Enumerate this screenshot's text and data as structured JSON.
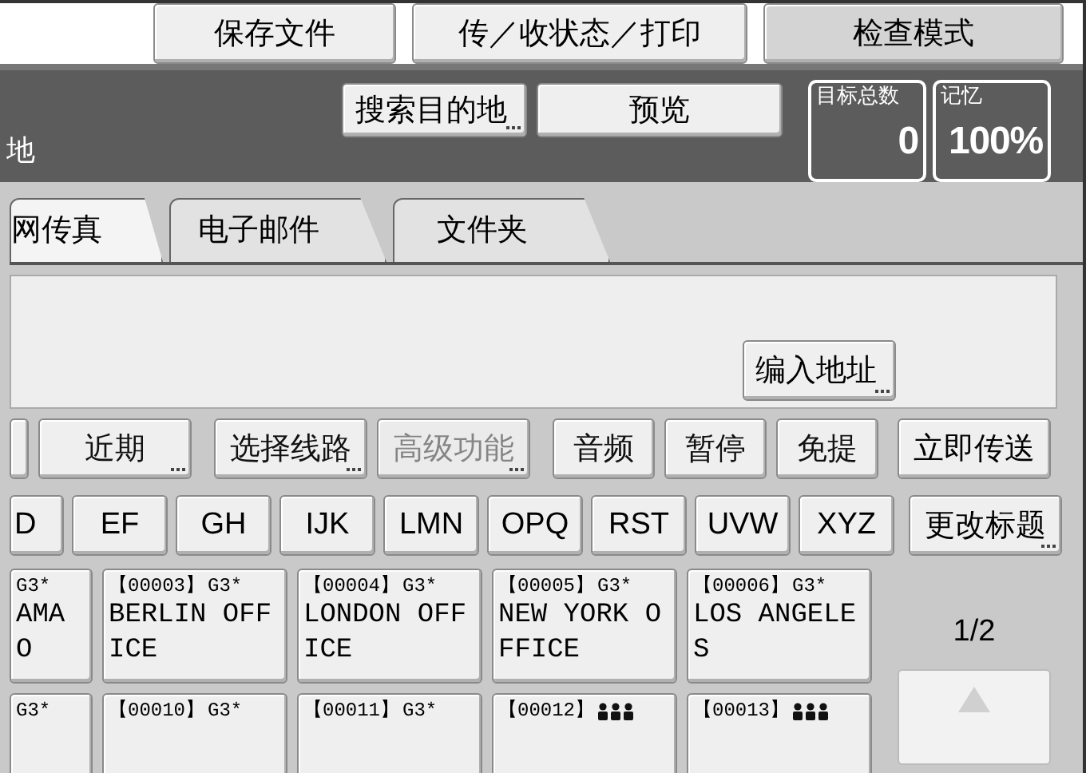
{
  "top_buttons": [
    {
      "label": "保存文件",
      "selected": false
    },
    {
      "label": "传／收状态／打印",
      "selected": false
    },
    {
      "label": "检查模式",
      "selected": true
    }
  ],
  "band": {
    "title": "地",
    "search_button": {
      "label": "搜索目的地",
      "submenu": true
    },
    "preview_button": "预览",
    "counters": [
      {
        "label": "目标总数",
        "value": "0"
      },
      {
        "label": "记忆",
        "value": "100%"
      }
    ]
  },
  "tabs": [
    {
      "label": "网传真",
      "selected": true
    },
    {
      "label": "电子邮件",
      "selected": false
    },
    {
      "label": "文件夹",
      "selected": false
    }
  ],
  "edit_address_button": {
    "label": "编入地址",
    "submenu": true
  },
  "function_buttons": [
    {
      "label": "近期",
      "submenu": true,
      "disabled": false
    },
    {
      "label": "选择线路",
      "submenu": true,
      "disabled": false
    },
    {
      "label": "高级功能",
      "submenu": true,
      "disabled": true
    },
    {
      "label": "音频",
      "submenu": false,
      "disabled": false
    },
    {
      "label": "暂停",
      "submenu": false,
      "disabled": false
    },
    {
      "label": "免提",
      "submenu": false,
      "disabled": false
    }
  ],
  "send_now_button": "立即传送",
  "index_keys": [
    "D",
    "EF",
    "GH",
    "IJK",
    "LMN",
    "OPQ",
    "RST",
    "UVW",
    "XYZ"
  ],
  "change_title_button": {
    "label": "更改标题",
    "submenu": true
  },
  "destinations": [
    [
      {
        "kind": "single",
        "line": "G3*",
        "name": "AMA O"
      },
      {
        "kind": "single",
        "number": "【00003】",
        "line": "G3*",
        "name": "BERLIN OFFICE"
      },
      {
        "kind": "single",
        "number": "【00004】",
        "line": "G3*",
        "name": "LONDON OFFICE"
      },
      {
        "kind": "single",
        "number": "【00005】",
        "line": "G3*",
        "name": "NEW YORK OFFICE"
      },
      {
        "kind": "single",
        "number": "【00006】",
        "line": "G3*",
        "name": "LOS ANGELES"
      }
    ],
    [
      {
        "kind": "single",
        "line": "G3*"
      },
      {
        "kind": "single",
        "number": "【00010】",
        "line": "G3*"
      },
      {
        "kind": "single",
        "number": "【00011】",
        "line": "G3*"
      },
      {
        "kind": "group",
        "number": "【00012】"
      },
      {
        "kind": "group",
        "number": "【00013】"
      }
    ]
  ],
  "page_indicator": "1/2"
}
